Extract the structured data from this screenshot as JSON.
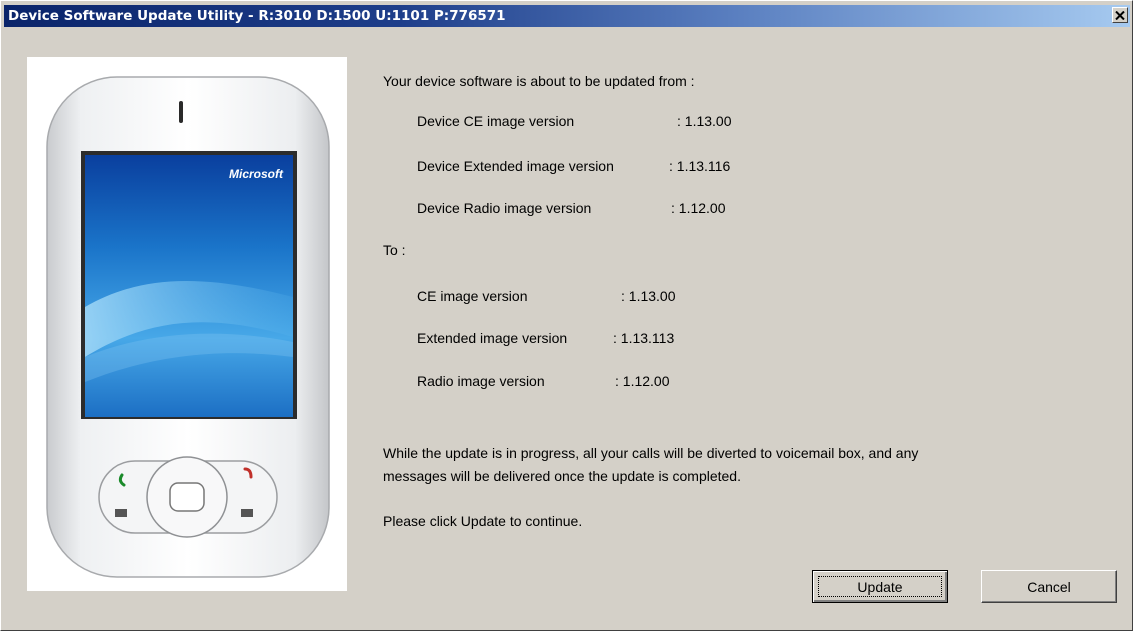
{
  "window": {
    "title": "Device Software Update Utility - R:3010 D:1500 U:1101 P:776571"
  },
  "device_image": {
    "brand_text": "Microsoft"
  },
  "current": {
    "intro": "Your device software is about to be updated from :",
    "rows": [
      {
        "label": "Device CE image version",
        "value": ": 1.13.00"
      },
      {
        "label": "Device Extended image version",
        "value": ": 1.13.116"
      },
      {
        "label": "Device Radio image version",
        "value": ": 1.12.00"
      }
    ]
  },
  "target": {
    "intro": "To :",
    "rows": [
      {
        "label": "CE image version",
        "value": ": 1.13.00"
      },
      {
        "label": "Extended image version",
        "value": ": 1.13.113"
      },
      {
        "label": "Radio image version",
        "value": ": 1.12.00"
      }
    ]
  },
  "notice": {
    "line1": "While the update is in progress, all your calls will be diverted to voicemail box, and any",
    "line2": "messages will be delivered once the update is completed.",
    "instruction": "Please click Update to continue."
  },
  "buttons": {
    "update": "Update",
    "cancel": "Cancel"
  },
  "colors": {
    "titlebar_start": "#0a246a",
    "titlebar_end": "#a6caf0",
    "dialog_bg": "#d4d0c8"
  }
}
